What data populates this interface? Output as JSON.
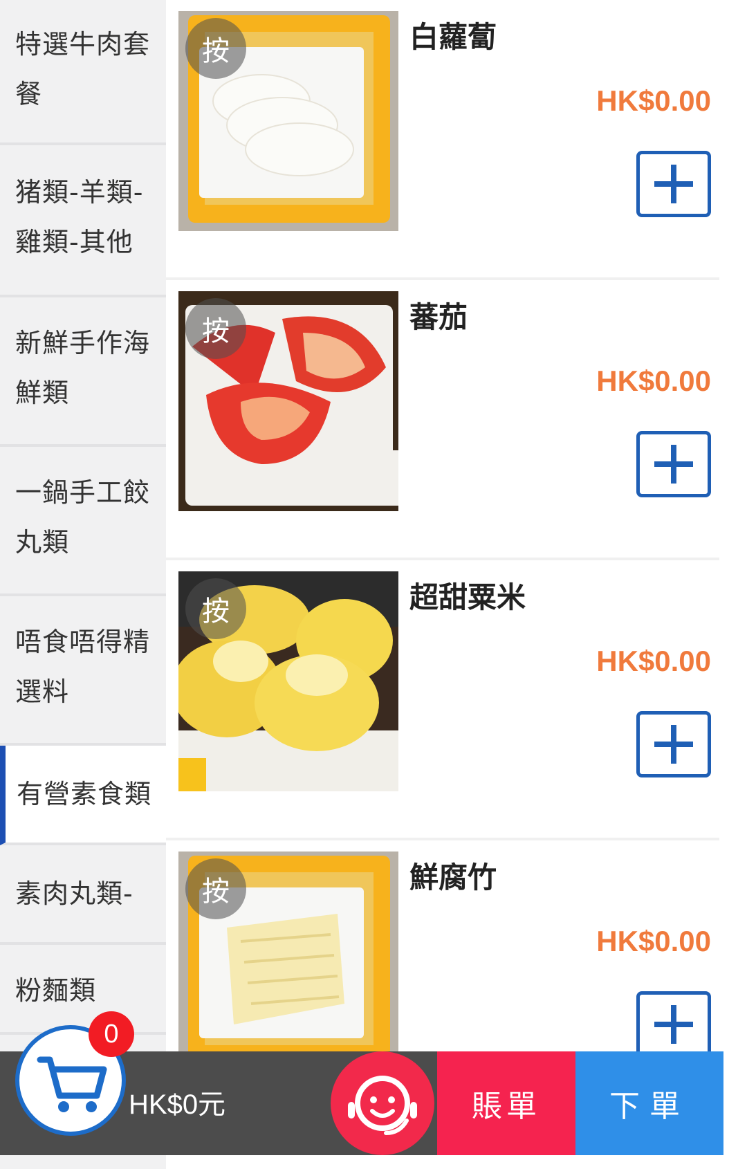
{
  "sidebar": {
    "categories": [
      {
        "label": "特選牛肉套餐"
      },
      {
        "label": "猪類-羊類-雞類-其他"
      },
      {
        "label": "新鮮手作海鮮類"
      },
      {
        "label": "一鍋手工餃丸類"
      },
      {
        "label": "唔食唔得精選料"
      },
      {
        "label": "有營素食類",
        "active": true
      },
      {
        "label": "素肉丸類-"
      },
      {
        "label": "粉麵類"
      }
    ]
  },
  "items": [
    {
      "name": "白蘿蔔",
      "price": "HK$0.00",
      "press_label": "按",
      "image": "white-radish-photo"
    },
    {
      "name": "蕃茄",
      "price": "HK$0.00",
      "press_label": "按",
      "image": "tomato-photo"
    },
    {
      "name": "超甜粟米",
      "price": "HK$0.00",
      "press_label": "按",
      "image": "sweet-corn-photo"
    },
    {
      "name": "鮮腐竹",
      "price": "HK$0.00",
      "press_label": "按",
      "image": "fresh-beancurd-sheet-photo"
    }
  ],
  "bottom_bar": {
    "cart_count": "0",
    "total": "HK$0元",
    "bill_label": "賬單",
    "order_label": "下單",
    "icons": {
      "cart": "cart-icon",
      "service": "customer-service-icon"
    }
  },
  "colors": {
    "accent": "#1d4fb3",
    "price": "#f07a3c",
    "add_button": "#1f5fb5",
    "bill": "#f5234f",
    "order": "#2f8fe8",
    "badge": "#f21c24"
  }
}
